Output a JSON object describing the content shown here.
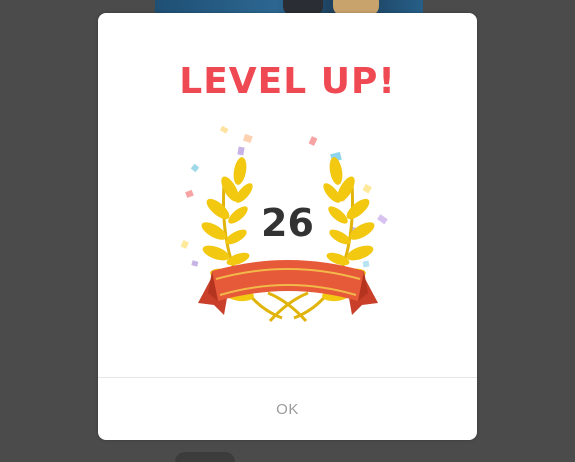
{
  "dialog": {
    "title": "LEVEL UP!",
    "level": "26",
    "ok_label": "OK"
  },
  "icons": {
    "emblem": "laurel-wreath-ribbon-icon",
    "confetti": "confetti-icon"
  },
  "colors": {
    "title": "#ef4a54",
    "laurel": "#f2c811",
    "ribbon": "#e65a3a",
    "ribbon_stripe": "#f3b84a",
    "level_text": "#333333",
    "ok_text": "#9b9b9b",
    "overlay": "#4b4b4b"
  }
}
